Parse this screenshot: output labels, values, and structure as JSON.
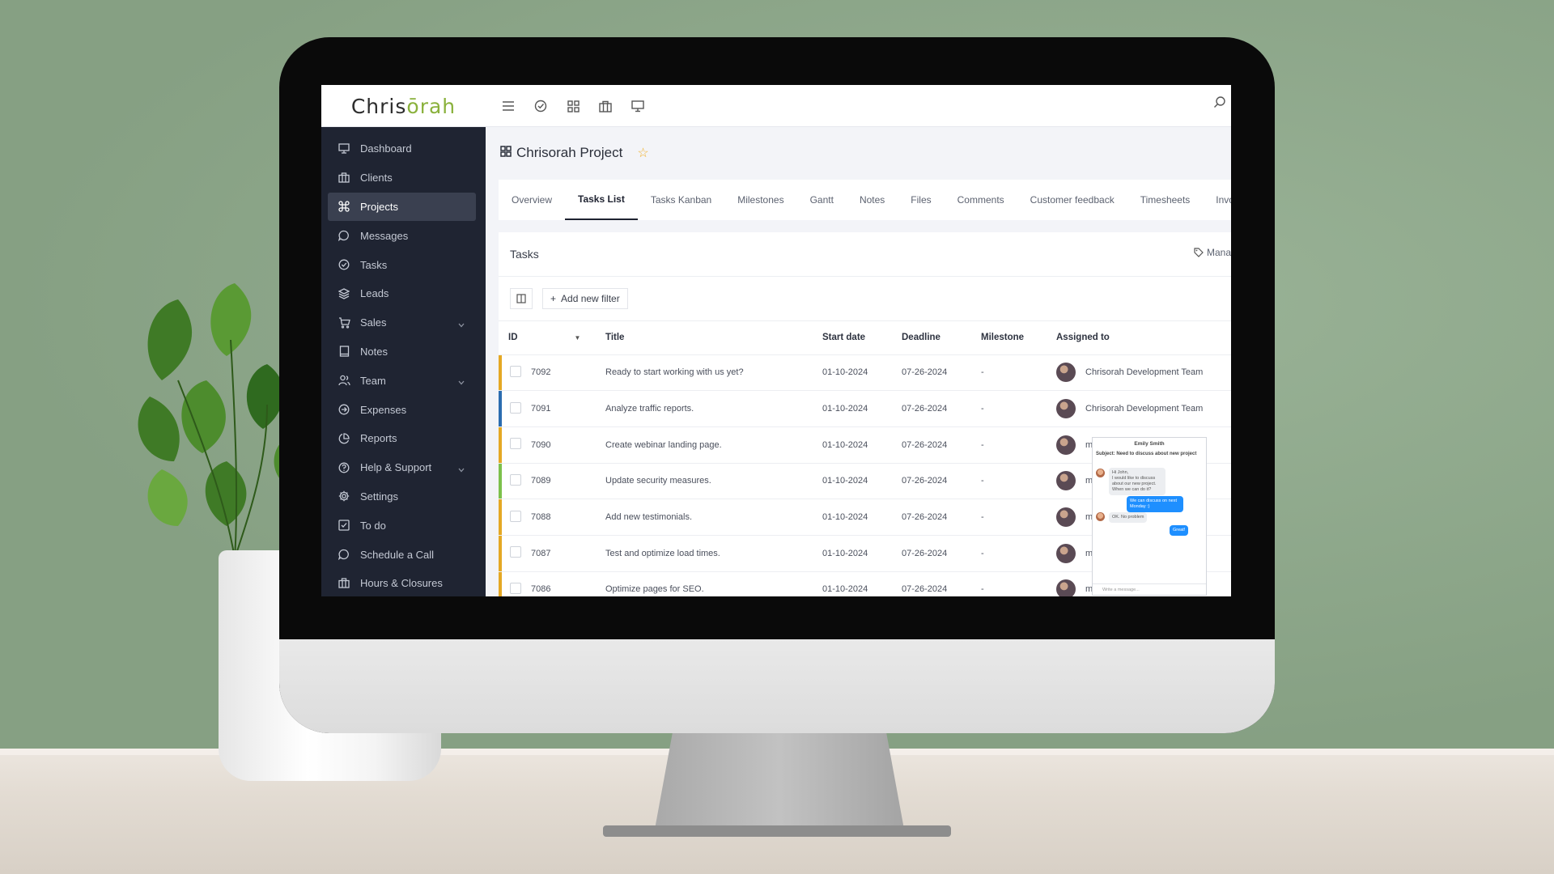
{
  "app": {
    "logo_prefix": "Chris",
    "logo_accent": "ōrah"
  },
  "sidebar": {
    "items": [
      {
        "label": "Dashboard",
        "icon": "monitor-icon"
      },
      {
        "label": "Clients",
        "icon": "briefcase-icon"
      },
      {
        "label": "Projects",
        "icon": "command-icon",
        "active": true
      },
      {
        "label": "Messages",
        "icon": "message-icon"
      },
      {
        "label": "Tasks",
        "icon": "check-circle-icon"
      },
      {
        "label": "Leads",
        "icon": "layers-icon"
      },
      {
        "label": "Sales",
        "icon": "cart-icon",
        "expandable": true
      },
      {
        "label": "Notes",
        "icon": "book-icon"
      },
      {
        "label": "Team",
        "icon": "users-icon",
        "expandable": true
      },
      {
        "label": "Expenses",
        "icon": "arrow-circle-icon"
      },
      {
        "label": "Reports",
        "icon": "pie-chart-icon"
      },
      {
        "label": "Help & Support",
        "icon": "help-circle-icon",
        "expandable": true
      },
      {
        "label": "Settings",
        "icon": "gear-icon"
      },
      {
        "label": "To do",
        "icon": "checkbox-icon"
      },
      {
        "label": "Schedule a Call",
        "icon": "message-icon"
      },
      {
        "label": "Hours & Closures",
        "icon": "briefcase-icon"
      }
    ]
  },
  "project": {
    "title": "Chrisorah Project"
  },
  "tabs": [
    "Overview",
    "Tasks List",
    "Tasks Kanban",
    "Milestones",
    "Gantt",
    "Notes",
    "Files",
    "Comments",
    "Customer feedback",
    "Timesheets",
    "Invoices"
  ],
  "active_tab": "Tasks List",
  "tasks_card": {
    "title": "Tasks",
    "manage_label": "Mana",
    "add_filter_label": "Add new filter"
  },
  "table": {
    "headers": {
      "id": "ID",
      "title": "Title",
      "start": "Start date",
      "deadline": "Deadline",
      "milestone": "Milestone",
      "assigned": "Assigned to"
    },
    "rows": [
      {
        "id": "7092",
        "title": "Ready to start working with us yet?",
        "start": "01-10-2024",
        "deadline": "07-26-2024",
        "milestone": "-",
        "assigned": "Chrisorah Development Team",
        "color": "#e5a824"
      },
      {
        "id": "7091",
        "title": "Analyze traffic reports.",
        "start": "01-10-2024",
        "deadline": "07-26-2024",
        "milestone": "-",
        "assigned": "Chrisorah Development Team",
        "color": "#2b6cb0"
      },
      {
        "id": "7090",
        "title": "Create webinar landing page.",
        "start": "01-10-2024",
        "deadline": "07-26-2024",
        "milestone": "-",
        "assigned": "m",
        "color": "#e5a824"
      },
      {
        "id": "7089",
        "title": "Update security measures.",
        "start": "01-10-2024",
        "deadline": "07-26-2024",
        "milestone": "-",
        "assigned": "m",
        "color": "#7cc04b"
      },
      {
        "id": "7088",
        "title": "Add new testimonials.",
        "start": "01-10-2024",
        "deadline": "07-26-2024",
        "milestone": "-",
        "assigned": "m",
        "color": "#e5a824"
      },
      {
        "id": "7087",
        "title": "Test and optimize load times.",
        "start": "01-10-2024",
        "deadline": "07-26-2024",
        "milestone": "-",
        "assigned": "m",
        "color": "#e5a824"
      },
      {
        "id": "7086",
        "title": "Optimize pages for SEO.",
        "start": "01-10-2024",
        "deadline": "07-26-2024",
        "milestone": "-",
        "assigned": "m",
        "color": "#e5a824"
      }
    ]
  },
  "chat": {
    "name": "Emily Smith",
    "subject": "Subject: Need to discuss about new project",
    "msg1": "Hi John,\nI would like to discuss about our new project.\nWhen we can do it?",
    "msg2": "We can discuss on next Monday :)",
    "msg3": "OK. No problem",
    "msg4": "Great!",
    "input_placeholder": "Write a message..."
  }
}
